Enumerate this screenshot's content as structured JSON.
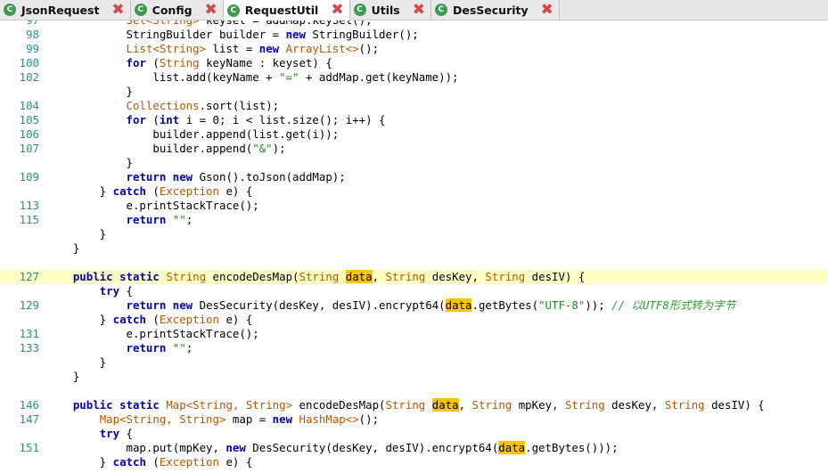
{
  "tabs": [
    {
      "label": "JsonRequest",
      "active": false,
      "icon": "class-icon"
    },
    {
      "label": "Config",
      "active": false,
      "icon": "class-icon"
    },
    {
      "label": "RequestUtil",
      "active": true,
      "icon": "class-icon"
    },
    {
      "label": "Utils",
      "active": false,
      "icon": "class-icon"
    },
    {
      "label": "DesSecurity",
      "active": false,
      "icon": "class-icon"
    }
  ],
  "colors": {
    "keyword": "#0000c0",
    "type": "#b85400",
    "string": "#1a8a1a",
    "comment": "#2e9a2e",
    "line_number": "#2e8c8c",
    "current_line": "#ffffc6",
    "occurrence_highlight": "#ffc400",
    "close_icon": "#d24a4a",
    "class_icon": "#3e9a53"
  },
  "editor": {
    "highlighted_line": "127",
    "lines": [
      {
        "n": "97",
        "hl": false,
        "t": [
          [
            "            ",
            ""
          ],
          [
            "Set<String>",
            "ty"
          ],
          [
            " keyset = addMap.keySet();",
            ""
          ]
        ]
      },
      {
        "n": "98",
        "hl": false,
        "t": [
          [
            "            StringBuilder builder = ",
            ""
          ],
          [
            "new",
            "kw"
          ],
          [
            " StringBuilder();",
            ""
          ]
        ]
      },
      {
        "n": "99",
        "hl": false,
        "t": [
          [
            "            ",
            ""
          ],
          [
            "List<String>",
            "ty"
          ],
          [
            " list = ",
            ""
          ],
          [
            "new",
            "kw"
          ],
          [
            " ",
            ""
          ],
          [
            "ArrayList<>",
            "ty"
          ],
          [
            "();",
            ""
          ]
        ]
      },
      {
        "n": "100",
        "hl": false,
        "t": [
          [
            "            ",
            ""
          ],
          [
            "for",
            "kw"
          ],
          [
            " (",
            ""
          ],
          [
            "String",
            "ty"
          ],
          [
            " keyName : keyset) {",
            ""
          ]
        ]
      },
      {
        "n": "102",
        "hl": false,
        "t": [
          [
            "                list.add(keyName + ",
            ""
          ],
          [
            "\"=\"",
            "st"
          ],
          [
            " + addMap.get(keyName));",
            ""
          ]
        ]
      },
      {
        "n": "",
        "hl": false,
        "t": [
          [
            "            }",
            ""
          ]
        ]
      },
      {
        "n": "104",
        "hl": false,
        "t": [
          [
            "            ",
            ""
          ],
          [
            "Collections",
            "ty"
          ],
          [
            ".sort(list);",
            ""
          ]
        ]
      },
      {
        "n": "105",
        "hl": false,
        "t": [
          [
            "            ",
            ""
          ],
          [
            "for",
            "kw"
          ],
          [
            " (",
            ""
          ],
          [
            "int",
            "kw"
          ],
          [
            " i = 0; i < list.size(); i++) {",
            ""
          ]
        ]
      },
      {
        "n": "106",
        "hl": false,
        "t": [
          [
            "                builder.append(list.get(i));",
            ""
          ]
        ]
      },
      {
        "n": "107",
        "hl": false,
        "t": [
          [
            "                builder.append(",
            ""
          ],
          [
            "\"&\"",
            "st"
          ],
          [
            ");",
            ""
          ]
        ]
      },
      {
        "n": "",
        "hl": false,
        "t": [
          [
            "            }",
            ""
          ]
        ]
      },
      {
        "n": "109",
        "hl": false,
        "t": [
          [
            "            ",
            ""
          ],
          [
            "return",
            "kw"
          ],
          [
            " ",
            ""
          ],
          [
            "new",
            "kw"
          ],
          [
            " Gson().toJson(addMap);",
            ""
          ]
        ]
      },
      {
        "n": "",
        "hl": false,
        "t": [
          [
            "        } ",
            ""
          ],
          [
            "catch",
            "kw"
          ],
          [
            " (",
            ""
          ],
          [
            "Exception",
            "ty"
          ],
          [
            " e) {",
            ""
          ]
        ]
      },
      {
        "n": "113",
        "hl": false,
        "t": [
          [
            "            e.printStackTrace();",
            ""
          ]
        ]
      },
      {
        "n": "115",
        "hl": false,
        "t": [
          [
            "            ",
            ""
          ],
          [
            "return",
            "kw"
          ],
          [
            " ",
            ""
          ],
          [
            "\"\"",
            "st"
          ],
          [
            ";",
            ""
          ]
        ]
      },
      {
        "n": "",
        "hl": false,
        "t": [
          [
            "        }",
            ""
          ]
        ]
      },
      {
        "n": "",
        "hl": false,
        "t": [
          [
            "    }",
            ""
          ]
        ]
      },
      {
        "n": "",
        "hl": false,
        "t": []
      },
      {
        "n": "127",
        "hl": true,
        "t": [
          [
            "    ",
            ""
          ],
          [
            "public",
            "kw"
          ],
          [
            " ",
            ""
          ],
          [
            "static",
            "kw"
          ],
          [
            " ",
            ""
          ],
          [
            "String",
            "ty"
          ],
          [
            " encodeDesMap(",
            ""
          ],
          [
            "String",
            "ty"
          ],
          [
            " ",
            ""
          ],
          [
            "data",
            "mk"
          ],
          [
            ", ",
            ""
          ],
          [
            "String",
            "ty"
          ],
          [
            " desKey, ",
            ""
          ],
          [
            "String",
            "ty"
          ],
          [
            " desIV) {",
            ""
          ]
        ]
      },
      {
        "n": "",
        "hl": false,
        "t": [
          [
            "        ",
            ""
          ],
          [
            "try",
            "kw"
          ],
          [
            " {",
            ""
          ]
        ]
      },
      {
        "n": "129",
        "hl": false,
        "t": [
          [
            "            ",
            ""
          ],
          [
            "return",
            "kw"
          ],
          [
            " ",
            ""
          ],
          [
            "new",
            "kw"
          ],
          [
            " DesSecurity(desKey, desIV).encrypt64(",
            ""
          ],
          [
            "data",
            "mk"
          ],
          [
            ".getBytes(",
            ""
          ],
          [
            "\"UTF-8\"",
            "st"
          ],
          [
            ")); ",
            ""
          ],
          [
            "// 以UTF8形式转为字节",
            "cm"
          ]
        ]
      },
      {
        "n": "",
        "hl": false,
        "t": [
          [
            "        } ",
            ""
          ],
          [
            "catch",
            "kw"
          ],
          [
            " (",
            ""
          ],
          [
            "Exception",
            "ty"
          ],
          [
            " e) {",
            ""
          ]
        ]
      },
      {
        "n": "131",
        "hl": false,
        "t": [
          [
            "            e.printStackTrace();",
            ""
          ]
        ]
      },
      {
        "n": "133",
        "hl": false,
        "t": [
          [
            "            ",
            ""
          ],
          [
            "return",
            "kw"
          ],
          [
            " ",
            ""
          ],
          [
            "\"\"",
            "st"
          ],
          [
            ";",
            ""
          ]
        ]
      },
      {
        "n": "",
        "hl": false,
        "t": [
          [
            "        }",
            ""
          ]
        ]
      },
      {
        "n": "",
        "hl": false,
        "t": [
          [
            "    }",
            ""
          ]
        ]
      },
      {
        "n": "",
        "hl": false,
        "t": []
      },
      {
        "n": "146",
        "hl": false,
        "t": [
          [
            "    ",
            ""
          ],
          [
            "public",
            "kw"
          ],
          [
            " ",
            ""
          ],
          [
            "static",
            "kw"
          ],
          [
            " ",
            ""
          ],
          [
            "Map<String, String>",
            "ty"
          ],
          [
            " encodeDesMap(",
            ""
          ],
          [
            "String",
            "ty"
          ],
          [
            " ",
            ""
          ],
          [
            "data",
            "mk"
          ],
          [
            ", ",
            ""
          ],
          [
            "String",
            "ty"
          ],
          [
            " mpKey, ",
            ""
          ],
          [
            "String",
            "ty"
          ],
          [
            " desKey, ",
            ""
          ],
          [
            "String",
            "ty"
          ],
          [
            " desIV) {",
            ""
          ]
        ]
      },
      {
        "n": "147",
        "hl": false,
        "t": [
          [
            "        ",
            ""
          ],
          [
            "Map<String, String>",
            "ty"
          ],
          [
            " map = ",
            ""
          ],
          [
            "new",
            "kw"
          ],
          [
            " ",
            ""
          ],
          [
            "HashMap<>",
            "ty"
          ],
          [
            "();",
            ""
          ]
        ]
      },
      {
        "n": "",
        "hl": false,
        "t": [
          [
            "        ",
            ""
          ],
          [
            "try",
            "kw"
          ],
          [
            " {",
            ""
          ]
        ]
      },
      {
        "n": "151",
        "hl": false,
        "t": [
          [
            "            map.put(mpKey, ",
            ""
          ],
          [
            "new",
            "kw"
          ],
          [
            " DesSecurity(desKey, desIV).encrypt64(",
            ""
          ],
          [
            "data",
            "mk"
          ],
          [
            ".getBytes()));",
            ""
          ]
        ]
      },
      {
        "n": "",
        "hl": false,
        "t": [
          [
            "        } ",
            ""
          ],
          [
            "catch",
            "kw"
          ],
          [
            " (",
            ""
          ],
          [
            "Exception",
            "ty"
          ],
          [
            " e) {",
            ""
          ]
        ]
      }
    ]
  }
}
